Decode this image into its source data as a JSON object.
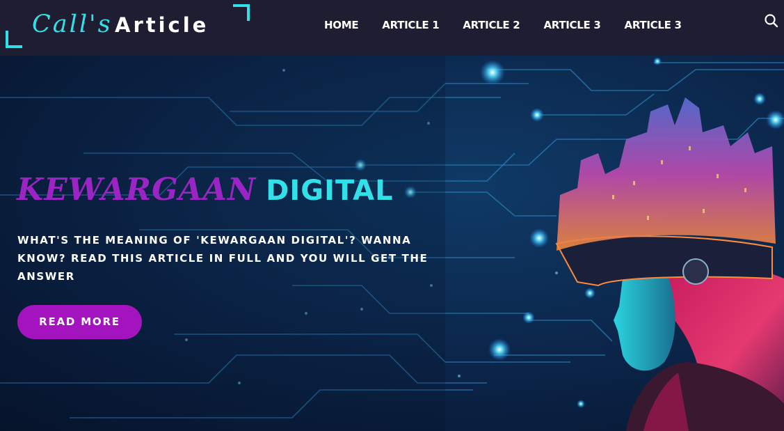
{
  "header": {
    "logo_script": "Call's",
    "logo_bold": "Article",
    "nav": [
      "HOME",
      "ARTICLE 1",
      "ARTICLE 2",
      "ARTICLE 3",
      "ARTICLE 3"
    ],
    "search_icon": "search-icon"
  },
  "hero": {
    "title_script": "KEWARGAAN",
    "title_bold": "DIGITAL",
    "description": "WHAT'S THE MEANING OF 'KEWARGAAN DIGITAL'? WANNA KNOW? READ THIS ARTICLE IN FULL AND YOU WILL GET THE ANSWER",
    "button_label": "READ MORE",
    "image": "vr-headset-woman-city-circuit-illustration"
  },
  "colors": {
    "header_bg": "#1e1d31",
    "accent_cyan": "#33e0e8",
    "accent_purple": "#a314bf",
    "hero_bg": "#0a1a33"
  }
}
